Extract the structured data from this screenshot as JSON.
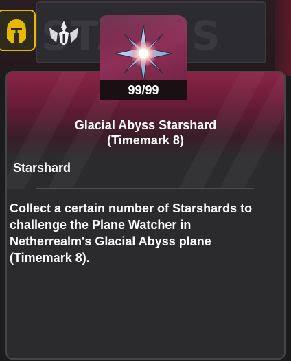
{
  "background": {
    "watermark": "STAGES"
  },
  "item": {
    "count": "99/99",
    "name": "Glacial Abyss Starshard (Timemark 8)",
    "type": "Starshard",
    "description": "Collect a certain number of Starshards to challenge the Plane Watcher in Netherrealm's Glacial Abyss plane (Timemark 8).",
    "icon": "starshard-icon"
  },
  "colors": {
    "badge_border": "#e6b800",
    "tile_accent": "#8e2f58",
    "card_bg": "#2b2b2e"
  }
}
